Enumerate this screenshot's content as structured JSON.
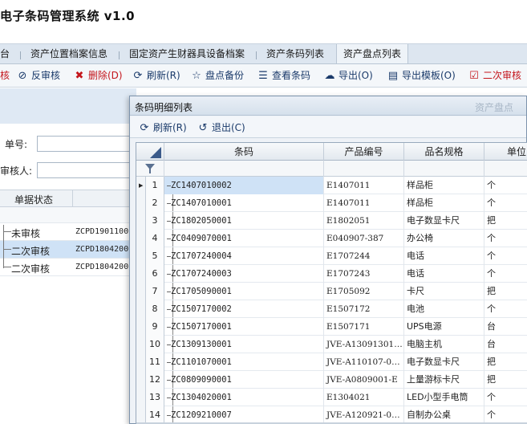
{
  "app": {
    "title": "电子条码管理系统 v1.0"
  },
  "tabs": [
    {
      "label": "台",
      "active": false
    },
    {
      "label": "资产位置档案信息",
      "active": false
    },
    {
      "label": "固定资产生财器具设备档案",
      "active": false
    },
    {
      "label": "资产条码列表",
      "active": false
    },
    {
      "label": "资产盘点列表",
      "active": true
    }
  ],
  "toolbar": {
    "items": [
      {
        "label": "核",
        "icon": "",
        "name": "approve-partial"
      },
      {
        "label": "反审核",
        "icon": "reverse-approve-icon",
        "name": "reverse-approve"
      },
      {
        "label": "删除(D)",
        "icon": "delete-x-icon",
        "name": "delete"
      },
      {
        "label": "刷新(R)",
        "icon": "refresh-icon",
        "name": "refresh"
      },
      {
        "label": "盘点备份",
        "icon": "star-icon",
        "name": "inventory-backup"
      },
      {
        "label": "查看条码",
        "icon": "list-icon",
        "name": "view-barcode"
      },
      {
        "label": "导出(O)",
        "icon": "cloud-upload-icon",
        "name": "export"
      },
      {
        "label": "导出模板(O)",
        "icon": "document-icon",
        "name": "export-template"
      },
      {
        "label": "二次审核",
        "icon": "checkbox-icon",
        "name": "second-approve"
      }
    ]
  },
  "form": {
    "order_no_label": "单号:",
    "reviewer_label": "审核人:"
  },
  "bg_table": {
    "header": "单据状态",
    "rows": [
      {
        "status": "未审核",
        "no": "ZCPD1901100"
      },
      {
        "status": "二次审核",
        "no": "ZCPD1804200"
      },
      {
        "status": "二次审核",
        "no": "ZCPD1804200"
      }
    ]
  },
  "dialog": {
    "title": "条码明细列表",
    "ghost_title": "资产盘点",
    "refresh_label": "刷新(R)",
    "exit_label": "退出(C)",
    "columns": [
      "条码",
      "产品编号",
      "品名规格",
      "单位"
    ],
    "rows": [
      {
        "n": "1",
        "code": "ZC1407010002",
        "pno": "E1407011",
        "name": "样品柜",
        "unit": "个"
      },
      {
        "n": "2",
        "code": "ZC1407010001",
        "pno": "E1407011",
        "name": "样品柜",
        "unit": "个"
      },
      {
        "n": "3",
        "code": "ZC1802050001",
        "pno": "E1802051",
        "name": "电子数显卡尺",
        "unit": "把"
      },
      {
        "n": "4",
        "code": "ZC0409070001",
        "pno": "E040907-387",
        "name": "办公椅",
        "unit": "个"
      },
      {
        "n": "5",
        "code": "ZC1707240004",
        "pno": "E1707244",
        "name": "电话",
        "unit": "个"
      },
      {
        "n": "6",
        "code": "ZC1707240003",
        "pno": "E1707243",
        "name": "电话",
        "unit": "个"
      },
      {
        "n": "7",
        "code": "ZC1705090001",
        "pno": "E1705092",
        "name": "卡尺",
        "unit": "把"
      },
      {
        "n": "8",
        "code": "ZC1507170002",
        "pno": "E1507172",
        "name": "电池",
        "unit": "个"
      },
      {
        "n": "9",
        "code": "ZC1507170001",
        "pno": "E1507171",
        "name": "UPS电源",
        "unit": "台"
      },
      {
        "n": "10",
        "code": "ZC1309130001",
        "pno": "JVE-A13091301…",
        "name": "电脑主机",
        "unit": "台"
      },
      {
        "n": "11",
        "code": "ZC1101070001",
        "pno": "JVE-A110107-0…",
        "name": "电子数显卡尺",
        "unit": "把"
      },
      {
        "n": "12",
        "code": "ZC0809090001",
        "pno": "JVE-A0809001-E",
        "name": "上量游标卡尺",
        "unit": "把"
      },
      {
        "n": "13",
        "code": "ZC1304020001",
        "pno": "E1304021",
        "name": "LED小型手电筒",
        "unit": "个"
      },
      {
        "n": "14",
        "code": "ZC1209210007",
        "pno": "JVE-A120921-0…",
        "name": "自制办公桌",
        "unit": "个"
      }
    ]
  },
  "colors": {
    "accent": "#1a3a6a",
    "danger": "#c4161c",
    "selection": "#cfe2f6"
  }
}
